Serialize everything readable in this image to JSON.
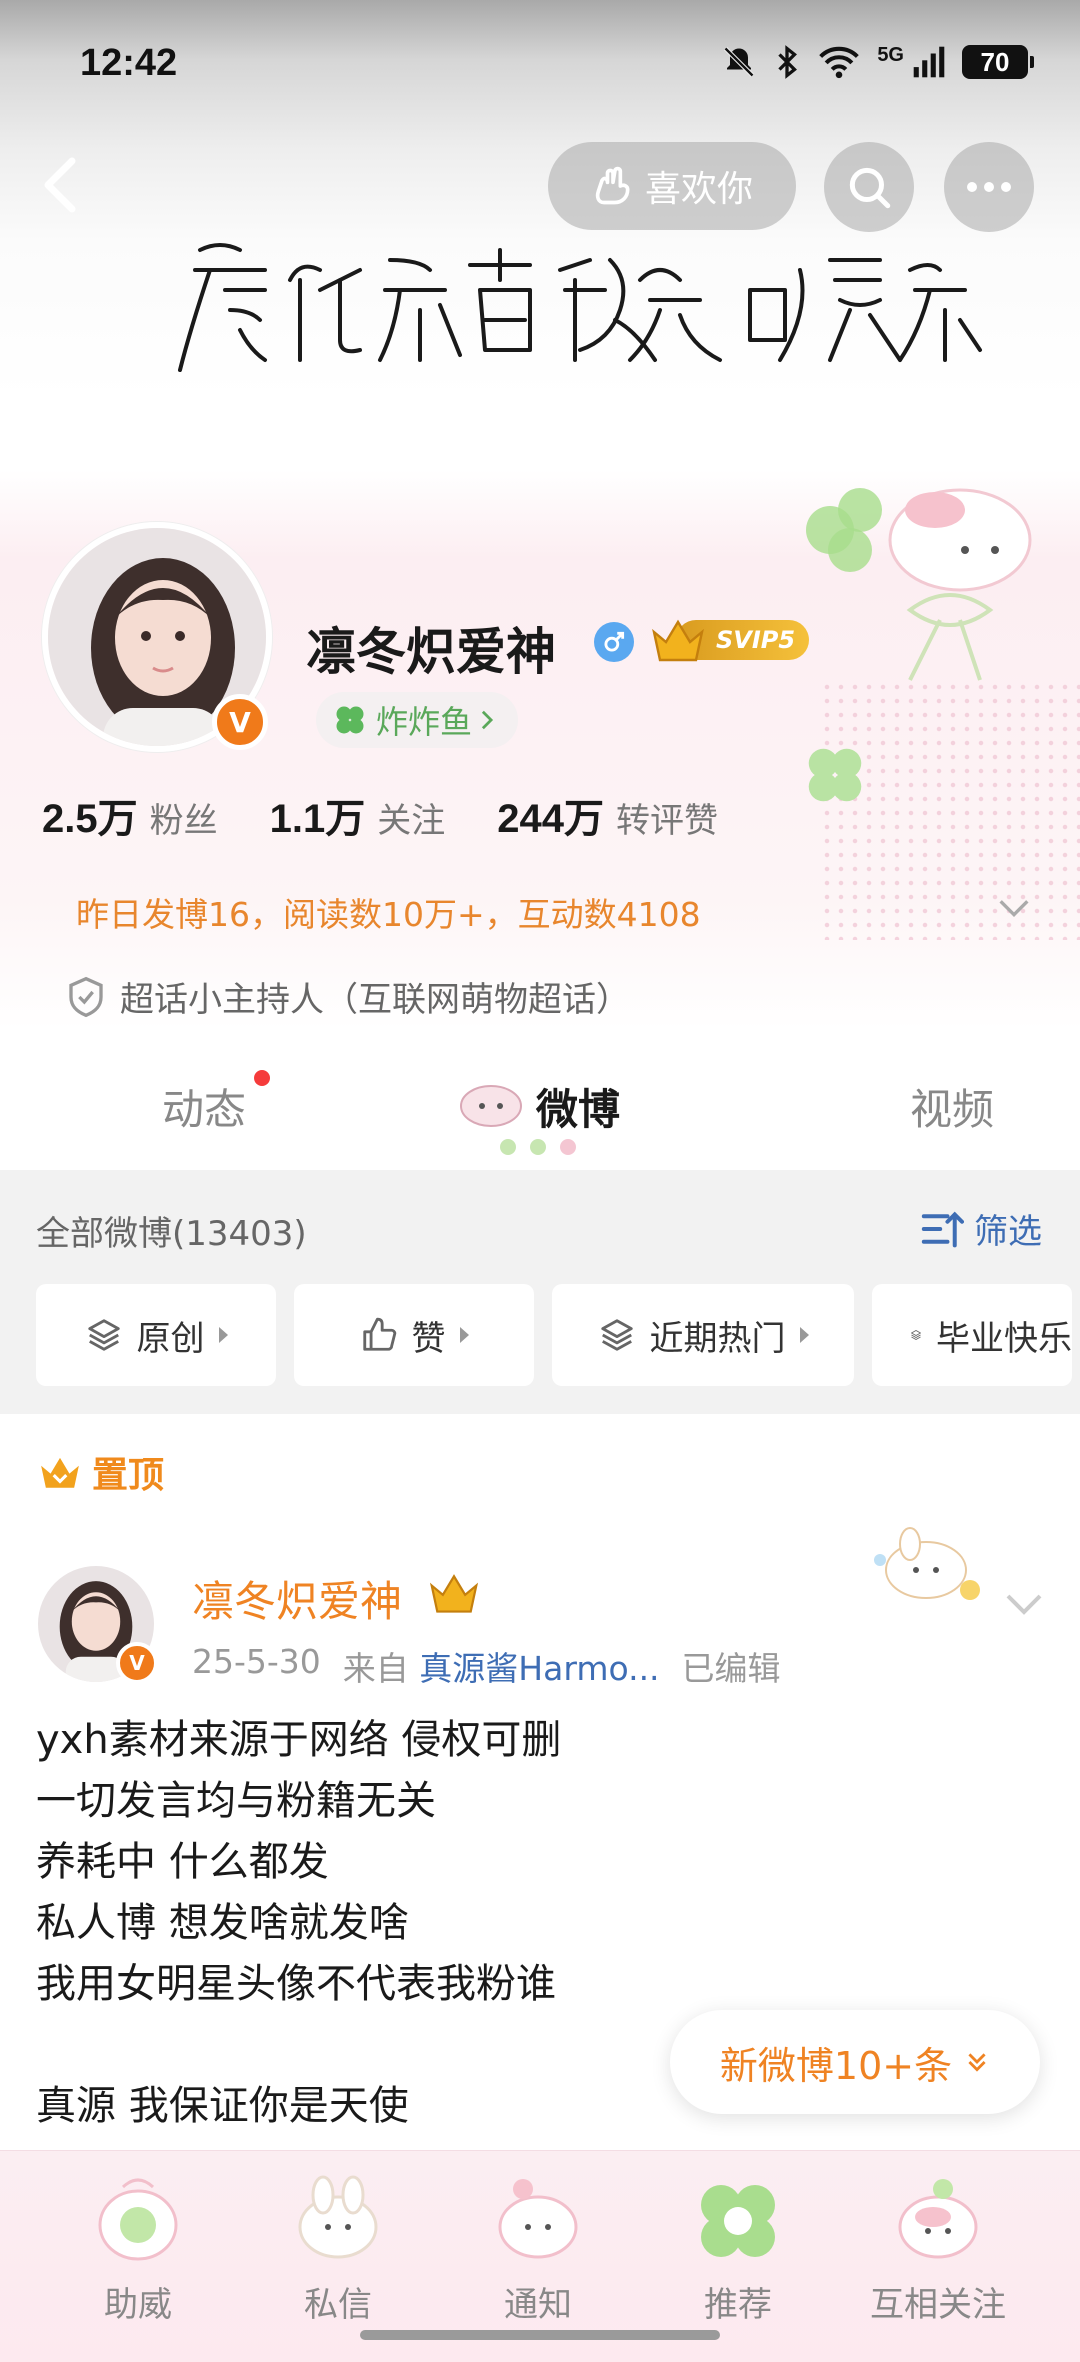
{
  "status_bar": {
    "time": "12:42",
    "network": "5G",
    "battery": "70"
  },
  "header": {
    "like_label": "喜欢你",
    "banner_slogan": "虚化所有镜头只聚焦你"
  },
  "profile": {
    "name": "凛冬炽爱神",
    "svip_label": "SVIP5",
    "group_label": "炸炸鱼",
    "stats": [
      {
        "value": "2.5万",
        "label": "粉丝"
      },
      {
        "value": "1.1万",
        "label": "关注"
      },
      {
        "value": "244万",
        "label": "转评赞"
      }
    ],
    "activity": "昨日发博16，阅读数10万+，互动数4108",
    "host_title": "超话小主持人（互联网萌物超话）"
  },
  "tabs": [
    {
      "label": "动态"
    },
    {
      "label": "微博"
    },
    {
      "label": "视频"
    }
  ],
  "filter": {
    "title": "全部微博(13403)",
    "filter_label": "筛选",
    "chips": [
      {
        "label": "原创"
      },
      {
        "label": "赞"
      },
      {
        "label": "近期热门"
      },
      {
        "label": "毕业快乐"
      }
    ]
  },
  "post": {
    "pinned_label": "置顶",
    "author": "凛冬炽爱神",
    "date": "25-5-30",
    "source_prefix": "来自",
    "source": "真源酱Harmo...",
    "edited": "已编辑",
    "text": "yxh素材来源于网络 侵权可删\n一切发言均与粉籍无关\n养耗中 什么都发\n私人博 想发啥就发啥\n我用女明星头像不代表我粉谁\n\n真源 我保证你是天使"
  },
  "new_posts_label": "新微博10+条",
  "bottom_nav": [
    {
      "label": "助威"
    },
    {
      "label": "私信"
    },
    {
      "label": "通知"
    },
    {
      "label": "推荐"
    },
    {
      "label": "互相关注"
    }
  ],
  "colors": {
    "accent_orange": "#ef8323",
    "link_blue": "#3e6db4",
    "badge_orange": "#f07a1a",
    "svip_gold": "#e0a52a"
  }
}
